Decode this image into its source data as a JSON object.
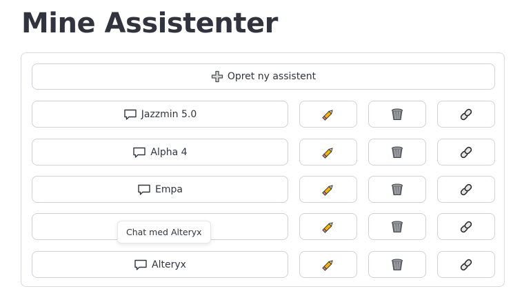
{
  "page_title": "Mine Assistenter",
  "create_button": {
    "label": "Opret ny assistent",
    "icon": "plus-icon"
  },
  "assistants": [
    {
      "name": "Jazzmin 5.0"
    },
    {
      "name": "Alpha 4"
    },
    {
      "name": "Empa"
    },
    {
      "name": ""
    },
    {
      "name": "Alteryx"
    }
  ],
  "row_icons": {
    "chat": "speech-bubble-icon",
    "edit": "pencil-icon",
    "delete": "wastebasket-icon",
    "link": "chain-link-icon"
  },
  "tooltip": {
    "text": "Chat med Alteryx"
  },
  "colors": {
    "text": "#31333f",
    "border": "#cfd1d8",
    "pencil_body": "#f5b400",
    "trash": "#7a7d82"
  }
}
